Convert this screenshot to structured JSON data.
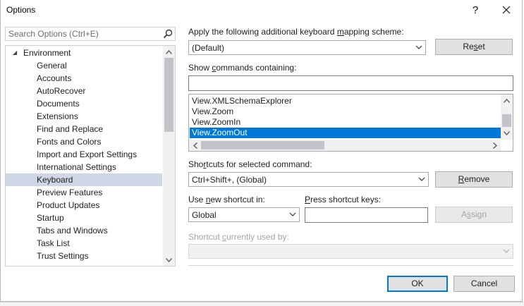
{
  "window": {
    "title": "Options",
    "help_glyph": "?",
    "close_glyph": "✕"
  },
  "search": {
    "placeholder": "Search Options (Ctrl+E)"
  },
  "tree": {
    "root": "Environment",
    "items": [
      "General",
      "Accounts",
      "AutoRecover",
      "Documents",
      "Extensions",
      "Find and Replace",
      "Fonts and Colors",
      "Import and Export Settings",
      "International Settings",
      "Keyboard",
      "Preview Features",
      "Product Updates",
      "Startup",
      "Tabs and Windows",
      "Task List",
      "Trust Settings"
    ],
    "selected": "Keyboard"
  },
  "mapping": {
    "label_pre": "Apply the following additional keyboard ",
    "label_u": "m",
    "label_post": "apping scheme:",
    "value": "(Default)",
    "reset_pre": "Re",
    "reset_u": "s",
    "reset_post": "et"
  },
  "commands": {
    "label_pre": "Show ",
    "label_u": "c",
    "label_post": "ommands containing:",
    "filter_value": "",
    "items": [
      "View.XMLSchemaExplorer",
      "View.Zoom",
      "View.ZoomIn",
      "View.ZoomOut"
    ],
    "selected": "View.ZoomOut"
  },
  "shortcuts": {
    "label_pre": "Sho",
    "label_u": "r",
    "label_post": "tcuts for selected command:",
    "value": "Ctrl+Shift+, (Global)",
    "remove_pre": "",
    "remove_u": "R",
    "remove_post": "emove"
  },
  "use_in": {
    "label_pre": "Use ",
    "label_u": "n",
    "label_post": "ew shortcut in:",
    "value": "Global"
  },
  "press_keys": {
    "label_pre": "",
    "label_u": "P",
    "label_post": "ress shortcut keys:",
    "value": "",
    "assign_pre": "A",
    "assign_u": "s",
    "assign_post": "sign"
  },
  "currently_used": {
    "label_pre": "Shortcut ",
    "label_u": "c",
    "label_post": "urrently used by:",
    "value": ""
  },
  "footer": {
    "ok": "OK",
    "cancel": "Cancel"
  },
  "colors": {
    "selection": "#0078d7",
    "tree_selection": "#cfd6e5",
    "disabled_text": "#a2a4a5"
  }
}
